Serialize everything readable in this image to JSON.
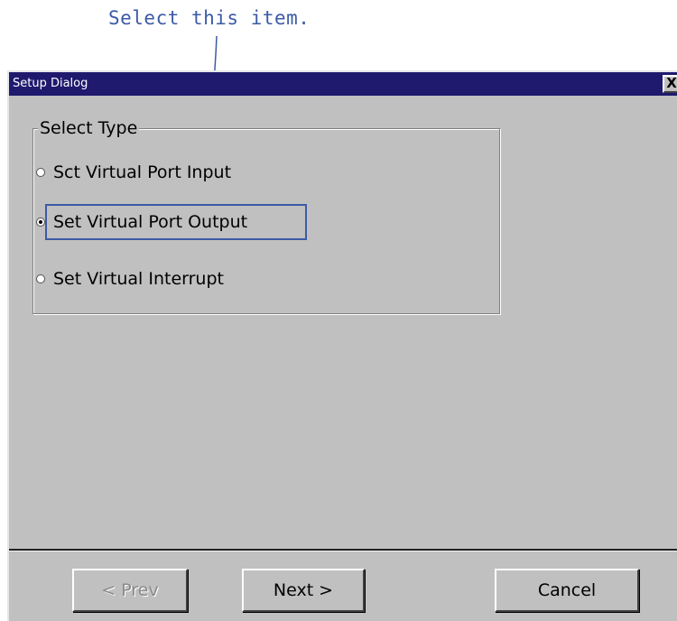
{
  "annotation": {
    "text": "Select this item."
  },
  "dialog": {
    "title": "Setup Dialog",
    "close_label": "X",
    "group": {
      "label": "Select Type",
      "options": [
        {
          "label": "Sct Virtual Port Input",
          "checked": false
        },
        {
          "label": "Set Virtual Port Output",
          "checked": true
        },
        {
          "label": "Set Virtual Interrupt",
          "checked": false
        }
      ]
    },
    "buttons": {
      "prev_label": "< Prev",
      "prev_enabled": false,
      "next_label": "Next >",
      "cancel_label": "Cancel"
    }
  },
  "colors": {
    "titlebar": "#1f1a6e",
    "annotation": "#3c5aa6",
    "dialog_face": "#c0c0c0"
  }
}
